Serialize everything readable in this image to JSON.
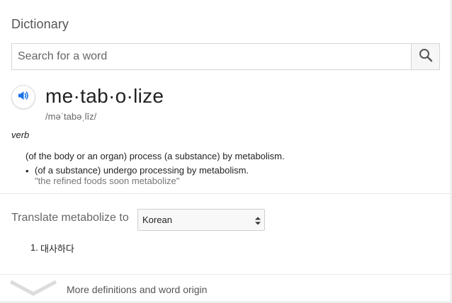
{
  "header": {
    "title": "Dictionary"
  },
  "search": {
    "placeholder": "Search for a word",
    "icon": "search-icon"
  },
  "entry": {
    "speaker_icon": "speaker-icon",
    "word": "me·tab·o·lize",
    "phonetic": "/məˈtabəˌlīz/",
    "part_of_speech": "verb",
    "definition": "(of the body or an organ) process (a substance) by metabolism.",
    "sub_definitions": [
      {
        "bullet": "•",
        "text": "(of a substance) undergo processing by metabolism.",
        "example": "\"the refined foods soon metabolize\""
      }
    ]
  },
  "translate": {
    "label": "Translate metabolize to",
    "language": "Korean",
    "results": [
      {
        "number": "1.",
        "text": "대사하다"
      }
    ]
  },
  "footer": {
    "more_label": "More definitions and word origin",
    "icon": "chevron-down-icon"
  },
  "colors": {
    "accent": "#1a73e8",
    "text": "#222222",
    "muted": "#777777"
  }
}
